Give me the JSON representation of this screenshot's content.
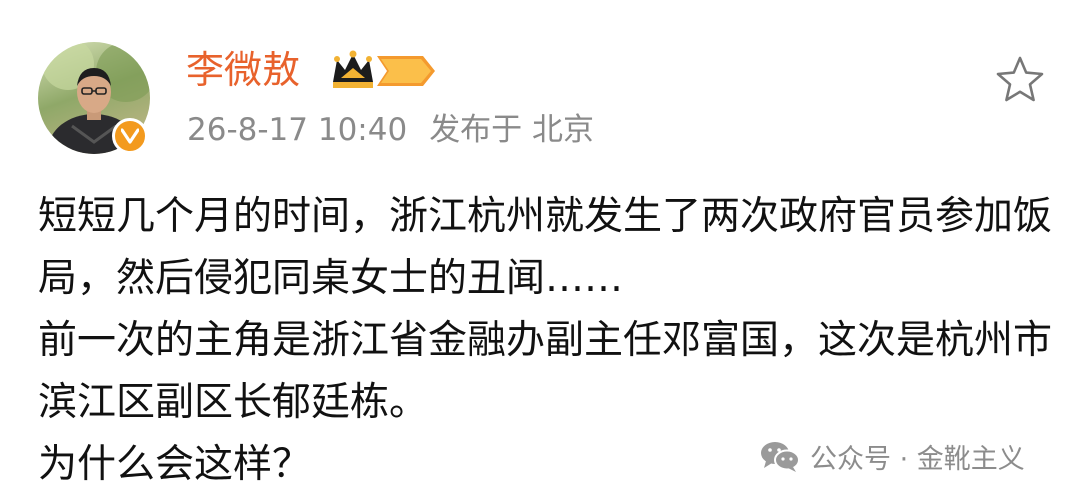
{
  "post": {
    "author": {
      "name": "李微敖",
      "vip_level": "II"
    },
    "date": "26-8-17 10:40",
    "published_from": "发布于 北京",
    "paragraphs": [
      "短短几个月的时间，浙江杭州就发生了两次政府官员参加饭局，然后侵犯同桌女士的丑闻……",
      "前一次的主角是浙江省金融办副主任邓富国，这次是杭州市滨江区副区长郁廷栋。",
      "为什么会这样？"
    ]
  },
  "watermark": {
    "text": "公众号 · 金靴主义"
  },
  "colors": {
    "username": "#e8622c",
    "meta": "#8a8a8a",
    "badge": "#f39a1e",
    "watermark": "#8c8c8c"
  },
  "icons": {
    "avatar": "profile-photo",
    "verified": "verified-badge-icon",
    "vip": "crown-icon",
    "favorite": "star-outline-icon",
    "watermark": "wechat-icon"
  }
}
